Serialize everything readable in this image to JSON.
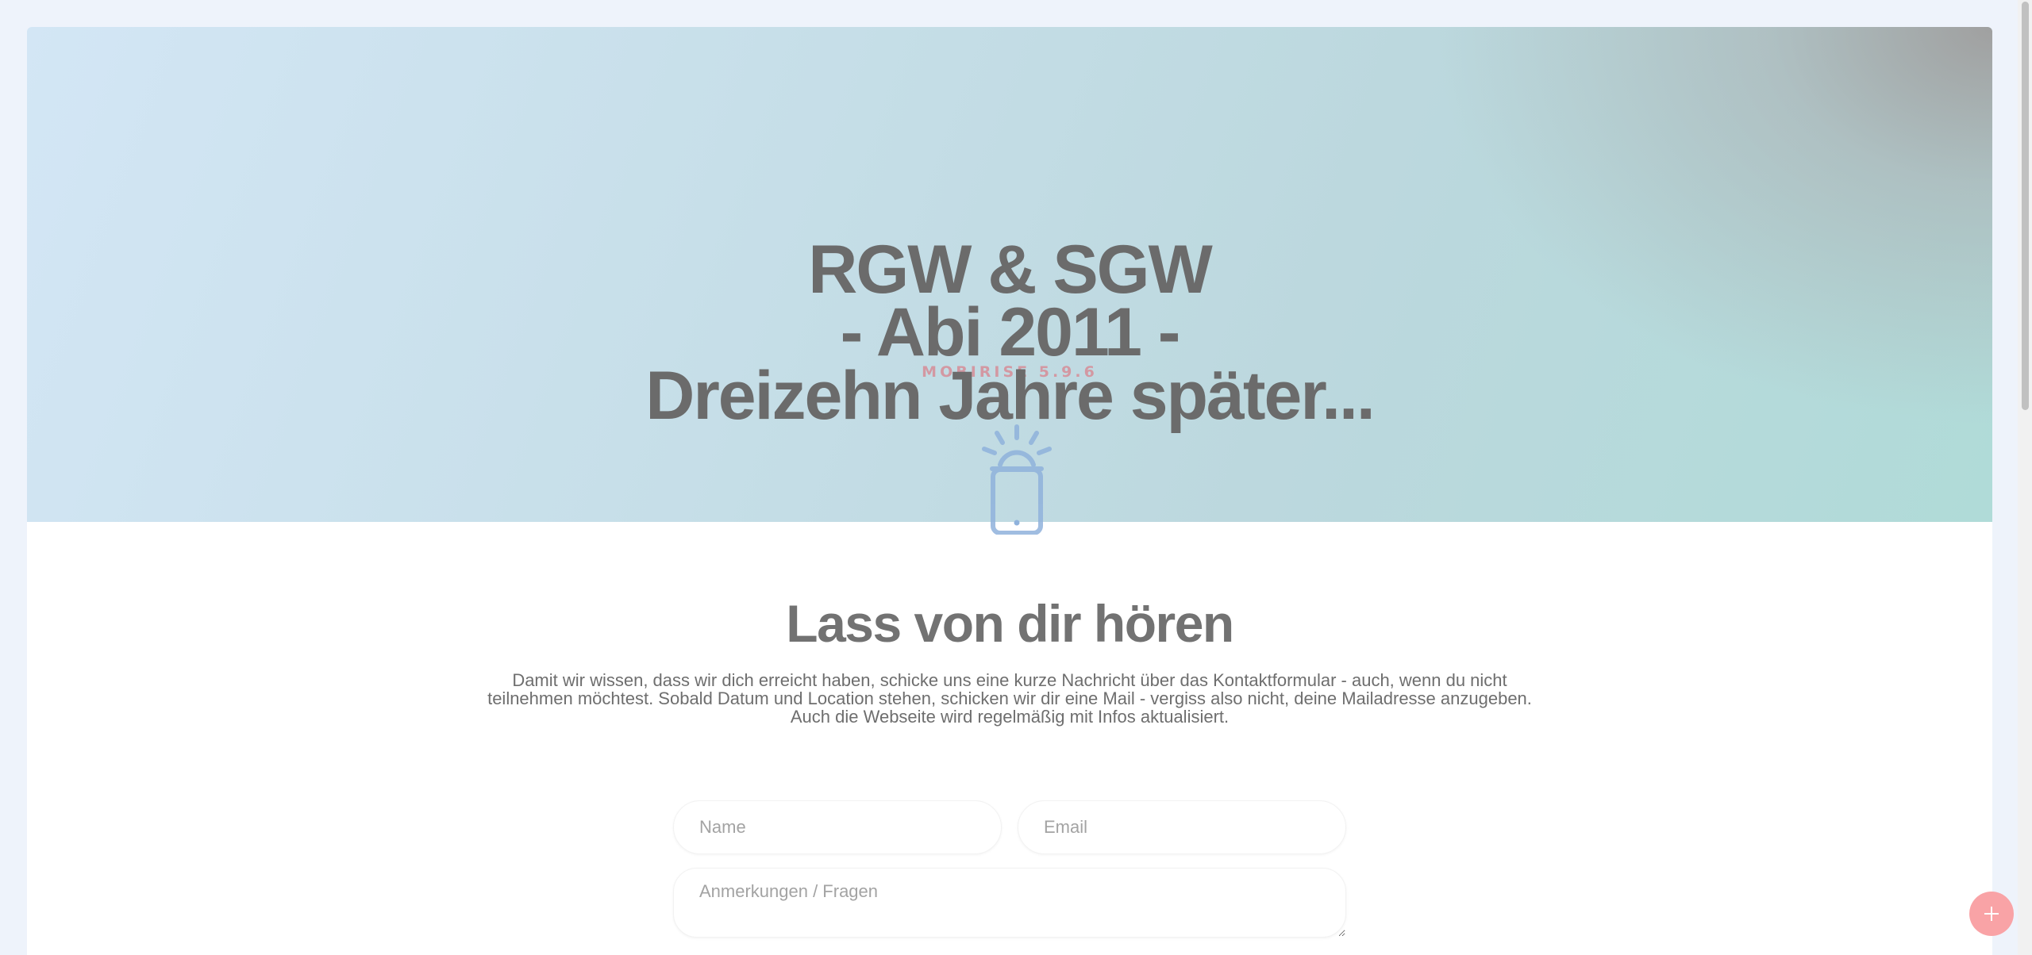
{
  "hero": {
    "title_line_1": "RGW & SGW",
    "title_line_2": "- Abi 2011 -",
    "title_line_3": "Dreizehn Jahre später...",
    "badge": "MOBIRISE  5.9.6",
    "phone_icon": "phone-alert-icon"
  },
  "contact": {
    "heading": "Lass von dir hören",
    "text": "Damit wir wissen, dass wir dich erreicht haben, schicke uns eine kurze Nachricht über das Kontaktformular - auch, wenn du nicht teilnehmen möchtest. Sobald Datum und Location stehen, schicken wir dir eine Mail - vergiss also nicht, deine Mailadresse anzugeben. Auch die Webseite wird regelmäßig mit Infos aktualisiert.",
    "name_placeholder": "Name",
    "email_placeholder": "Email",
    "message_placeholder": "Anmerkungen / Fragen"
  },
  "fab": {
    "icon": "plus-icon"
  },
  "colors": {
    "background": "#eef3fb",
    "hero_start": "#d3e6f5",
    "hero_end": "#b0dbd8",
    "title_text": "#6b6b6b",
    "fab": "#f9a3a6"
  }
}
